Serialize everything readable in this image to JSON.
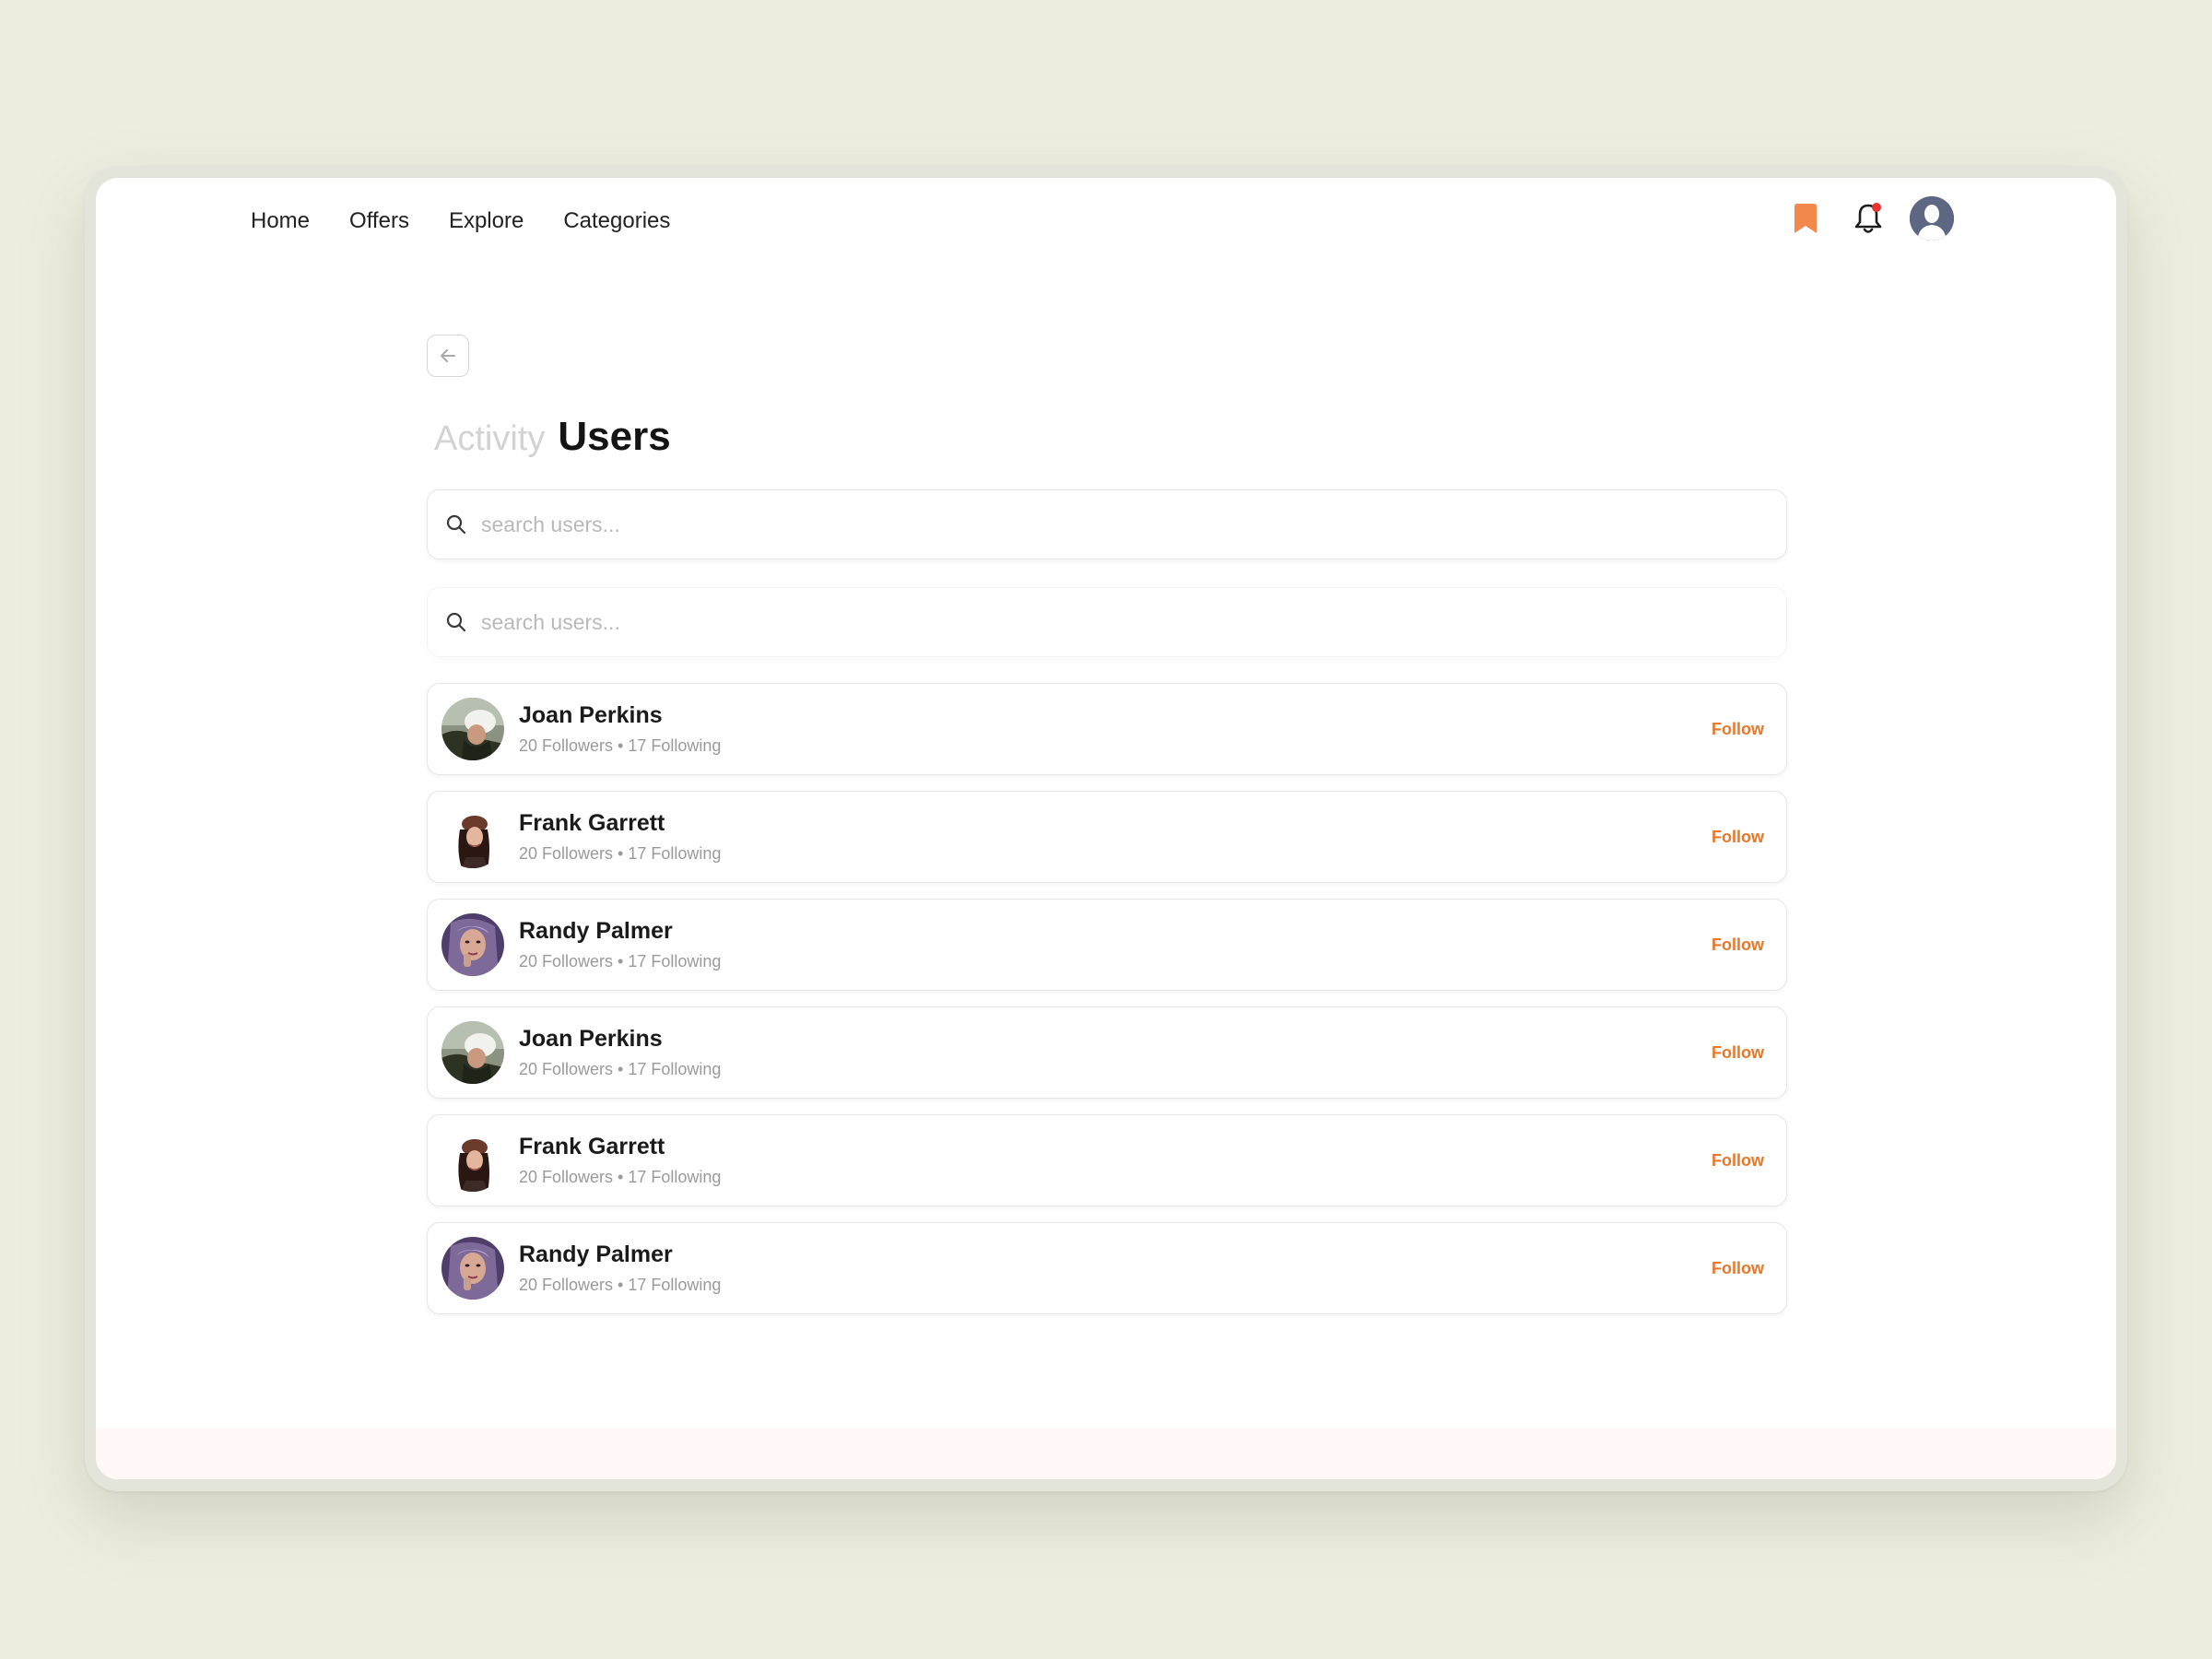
{
  "nav": {
    "items": [
      {
        "label": "Home"
      },
      {
        "label": "Offers"
      },
      {
        "label": "Explore"
      },
      {
        "label": "Categories"
      }
    ]
  },
  "header": {
    "icons": [
      "bookmark-icon",
      "bell-icon",
      "profile-avatar"
    ],
    "notification_dot_color": "#e8322d",
    "bookmark_color": "#f2884c"
  },
  "page": {
    "tab_inactive": "Activity",
    "tab_active": "Users"
  },
  "search": {
    "placeholder_1": "search users...",
    "placeholder_2": "search users..."
  },
  "users": [
    {
      "name": "Joan Perkins",
      "stats": "20 Followers • 17 Following",
      "action": "Follow",
      "avatar": "avatar-white-hat"
    },
    {
      "name": "Frank Garrett",
      "stats": "20 Followers • 17 Following",
      "action": "Follow",
      "avatar": "avatar-beret"
    },
    {
      "name": "Randy Palmer",
      "stats": "20 Followers • 17 Following",
      "action": "Follow",
      "avatar": "avatar-purple"
    },
    {
      "name": "Joan Perkins",
      "stats": "20 Followers • 17 Following",
      "action": "Follow",
      "avatar": "avatar-white-hat"
    },
    {
      "name": "Frank Garrett",
      "stats": "20 Followers • 17 Following",
      "action": "Follow",
      "avatar": "avatar-beret"
    },
    {
      "name": "Randy Palmer",
      "stats": "20 Followers • 17 Following",
      "action": "Follow",
      "avatar": "avatar-purple"
    }
  ],
  "colors": {
    "accent": "#e9772a",
    "background": "#edede0"
  }
}
